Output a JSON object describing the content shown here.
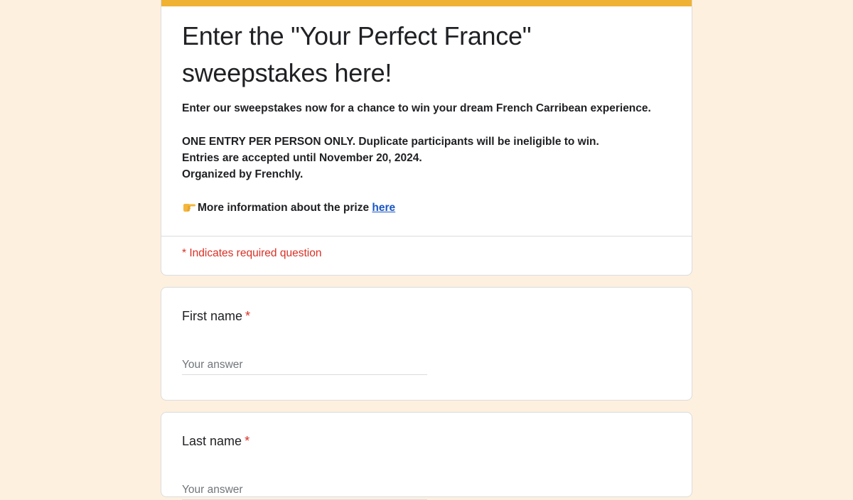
{
  "page": {
    "background_color": "#fdf0de",
    "accent_color": "#f0b232",
    "link_color": "#1a56c4",
    "required_color": "#d93025"
  },
  "header": {
    "title": "Enter the \"Your Perfect France\" sweepstakes here!",
    "description_lines": [
      "Enter our sweepstakes now for a chance to win your dream French Carribean experience.",
      "",
      "ONE ENTRY PER PERSON ONLY. Duplicate participants will be ineligible to win.",
      "Entries are accepted until November 20, 2024.",
      "Organized by Frenchly.",
      ""
    ],
    "prize_line": {
      "icon": "pointing-right-icon",
      "text": "More information about the prize ",
      "link_text": "here"
    },
    "required_note": "* Indicates required question"
  },
  "questions": [
    {
      "label": "First name",
      "required_marker": "*",
      "placeholder": "Your answer",
      "value": ""
    },
    {
      "label": "Last name",
      "required_marker": "*",
      "placeholder": "Your answer",
      "value": ""
    }
  ]
}
